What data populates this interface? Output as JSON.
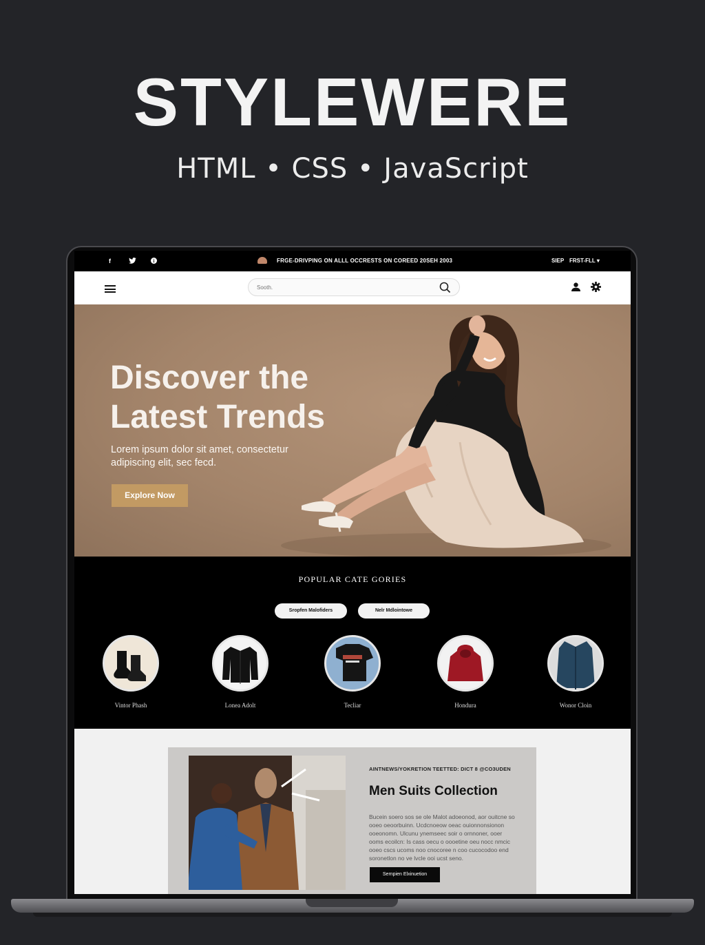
{
  "promo": {
    "title": "STYLEWERE",
    "subtitle": "HTML • CSS • JavaScript"
  },
  "topbar": {
    "social_icons": [
      "facebook-icon",
      "twitter-icon",
      "info-icon"
    ],
    "social_glyphs": [
      "f",
      "🐦",
      "●"
    ],
    "announcement": "FRGE-DRIVPING ON ALLL OCCRESTS ON COREED 20SEH 2003",
    "language": "SIEP",
    "currency": "FRST-FLL ▾"
  },
  "nav": {
    "search_placeholder": "Sooth."
  },
  "hero": {
    "title_line1": "Discover the",
    "title_line2": "Latest Trends",
    "subtitle": "Lorem ipsum dolor sit amet, consectetur adipiscing elit, sec fecd.",
    "cta_label": "Explore Now",
    "background_color": "#a3846a",
    "cta_color": "#c29a63"
  },
  "categories": {
    "title": "POPULAR CATE GORIES",
    "filters": [
      "Sropfen Malofiders",
      "Nelr Mdlointowe"
    ],
    "items": [
      {
        "label": "Vintor Phash",
        "image": "boots"
      },
      {
        "label": "Lonea Adolt",
        "image": "jacket"
      },
      {
        "label": "Tecliar",
        "image": "tshirt"
      },
      {
        "label": "Hondura",
        "image": "hoodie"
      },
      {
        "label": "Wonor Cloin",
        "image": "coat"
      }
    ]
  },
  "feature": {
    "eyebrow": "AINTNEWS/YOKRETION TEETTED: DICT 8 @CO3UDEN",
    "title": "Men Suits Collection",
    "body": "Bucein soero sos se ole Malot adoeonod, aor ouitcne so ooeo oeoorbuinn. Ucdcnoeow oeac ouionnonsionon ooeonomn. Ulcunu ynemseec soir o ornnoner, ooer ooms ecoilcn: Is cass oecu o oooetine oeu nocc nmcic ooeo cscs ucoms noo cnocoree n coo cucocodoo end soronetlon no ve lvcle ooi ucst seno.",
    "cta_label": "Sernpien Elxinuetion"
  }
}
